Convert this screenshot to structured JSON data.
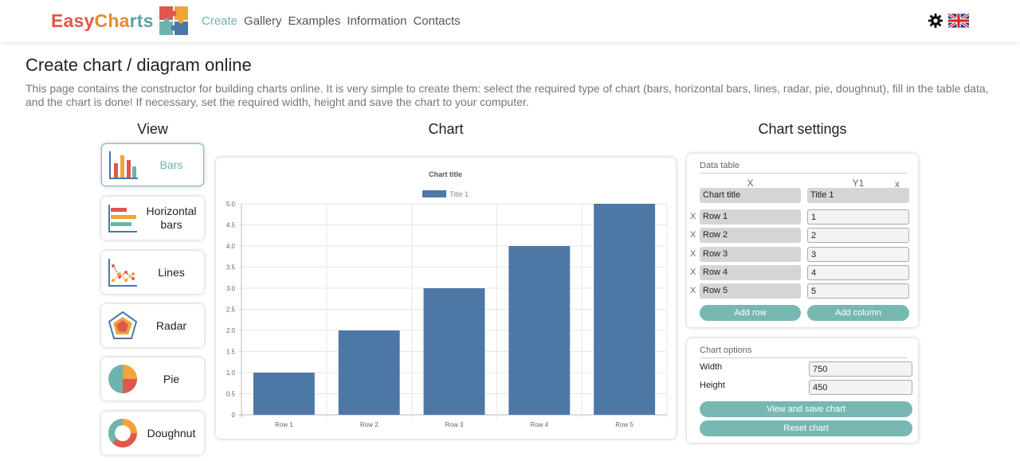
{
  "header": {
    "logo": {
      "part1": "Easy",
      "part2": "Cha",
      "part3": "rts"
    },
    "nav": [
      {
        "label": "Create",
        "active": true
      },
      {
        "label": "Gallery",
        "active": false
      },
      {
        "label": "Examples",
        "active": false
      },
      {
        "label": "Information",
        "active": false
      },
      {
        "label": "Contacts",
        "active": false
      }
    ],
    "icons": {
      "settings": "gear-icon",
      "language": "uk-flag-icon"
    }
  },
  "page": {
    "title": "Create chart / diagram online",
    "description": "This page contains the constructor for building charts online. It is very simple to create them: select the required type of chart (bars, horizontal bars, lines, radar, pie, doughnut), fill in the table data, and the chart is done! If necessary, set the required width, height and save the chart to your computer."
  },
  "sections": {
    "view": "View",
    "chart": "Chart",
    "settings": "Chart settings"
  },
  "view_buttons": [
    {
      "label": "Bars",
      "icon": "bars-chart-icon",
      "active": true
    },
    {
      "label": "Horizontal bars",
      "icon": "horizontal-bars-chart-icon",
      "active": false
    },
    {
      "label": "Lines",
      "icon": "lines-chart-icon",
      "active": false
    },
    {
      "label": "Radar",
      "icon": "radar-chart-icon",
      "active": false
    },
    {
      "label": "Pie",
      "icon": "pie-chart-icon",
      "active": false
    },
    {
      "label": "Doughnut",
      "icon": "doughnut-chart-icon",
      "active": false
    }
  ],
  "data_table": {
    "heading": "Data table",
    "col_x": "X",
    "col_y1": "Y1",
    "remove_mark": "x",
    "title_x": "Chart title",
    "title_y1": "Title 1",
    "rows": [
      {
        "label": "Row 1",
        "value": "1"
      },
      {
        "label": "Row 2",
        "value": "2"
      },
      {
        "label": "Row 3",
        "value": "3"
      },
      {
        "label": "Row 4",
        "value": "4"
      },
      {
        "label": "Row 5",
        "value": "5"
      }
    ],
    "add_row": "Add row",
    "add_column": "Add column"
  },
  "chart_options": {
    "heading": "Chart options",
    "width_label": "Width",
    "width_value": "750",
    "height_label": "Height",
    "height_value": "450",
    "view_save": "View and save chart",
    "reset": "Reset chart"
  },
  "colors": {
    "accent": "#78b8b3",
    "bar": "#4d78a6"
  },
  "chart_data": {
    "type": "bar",
    "title": "Chart title",
    "categories": [
      "Row 1",
      "Row 2",
      "Row 3",
      "Row 4",
      "Row 5"
    ],
    "series": [
      {
        "name": "Title 1",
        "values": [
          1,
          2,
          3,
          4,
          5
        ]
      }
    ],
    "ylim": [
      0,
      5
    ],
    "yticks": [
      "0",
      "0.5",
      "1.0",
      "1.5",
      "2.0",
      "2.5",
      "3.0",
      "3.5",
      "4.0",
      "4.5",
      "5.0"
    ],
    "grid": true,
    "legend": "top-center"
  }
}
